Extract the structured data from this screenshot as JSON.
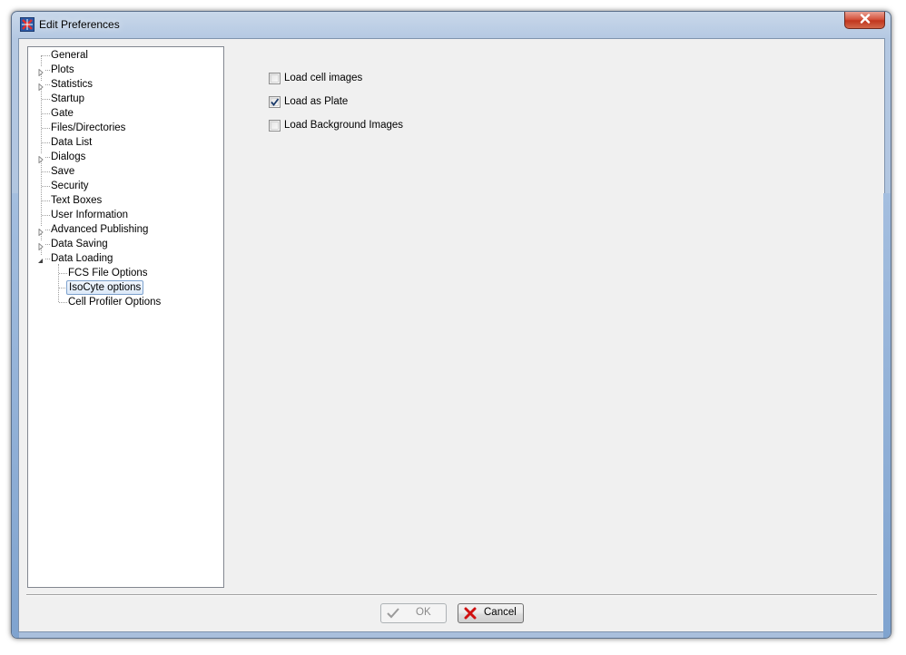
{
  "window": {
    "title": "Edit Preferences",
    "icons": {
      "app": "app-logo-icon",
      "close": "close-icon"
    }
  },
  "tree": {
    "items": [
      {
        "label": "General",
        "expandable": false,
        "level": 0
      },
      {
        "label": "Plots",
        "expandable": true,
        "expanded": false,
        "level": 0
      },
      {
        "label": "Statistics",
        "expandable": true,
        "expanded": false,
        "level": 0
      },
      {
        "label": "Startup",
        "expandable": false,
        "level": 0
      },
      {
        "label": "Gate",
        "expandable": false,
        "level": 0
      },
      {
        "label": "Files/Directories",
        "expandable": false,
        "level": 0
      },
      {
        "label": "Data List",
        "expandable": false,
        "level": 0
      },
      {
        "label": "Dialogs",
        "expandable": true,
        "expanded": false,
        "level": 0
      },
      {
        "label": "Save",
        "expandable": false,
        "level": 0
      },
      {
        "label": "Security",
        "expandable": false,
        "level": 0
      },
      {
        "label": "Text Boxes",
        "expandable": false,
        "level": 0
      },
      {
        "label": "User Information",
        "expandable": false,
        "level": 0
      },
      {
        "label": "Advanced Publishing",
        "expandable": true,
        "expanded": false,
        "level": 0
      },
      {
        "label": "Data Saving",
        "expandable": true,
        "expanded": false,
        "level": 0
      },
      {
        "label": "Data Loading",
        "expandable": true,
        "expanded": true,
        "level": 0
      },
      {
        "label": "FCS File Options",
        "expandable": false,
        "level": 1
      },
      {
        "label": "IsoCyte options",
        "expandable": false,
        "level": 1,
        "selected": true
      },
      {
        "label": "Cell Profiler Options",
        "expandable": false,
        "level": 1
      }
    ]
  },
  "options": {
    "load_cell_images": {
      "label": "Load cell images",
      "checked": false
    },
    "load_as_plate": {
      "label": "Load as Plate",
      "checked": true
    },
    "load_background_images": {
      "label": "Load Background Images",
      "checked": false
    }
  },
  "buttons": {
    "ok": {
      "label": "OK",
      "enabled": false,
      "icon": "checkmark-icon"
    },
    "cancel": {
      "label": "Cancel",
      "enabled": true,
      "icon": "red-x-icon"
    }
  },
  "colors": {
    "selection_border": "#7da2ce",
    "cancel_icon": "#d01010",
    "check_mark": "#1a3a6a"
  }
}
